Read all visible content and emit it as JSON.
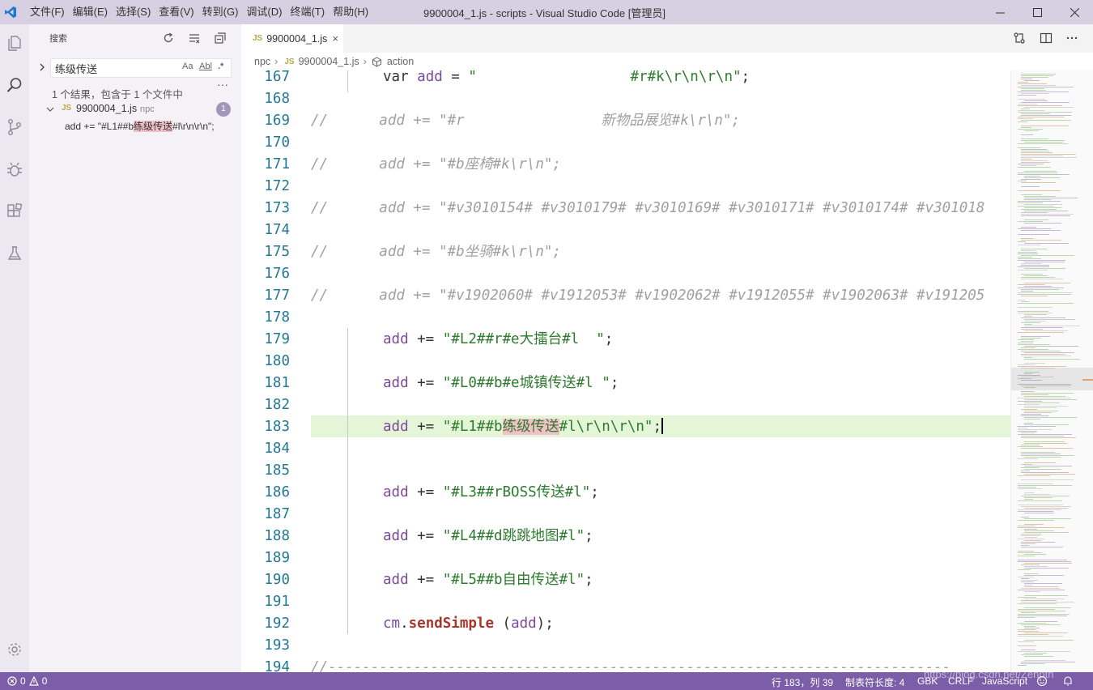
{
  "window": {
    "title": "9900004_1.js - scripts - Visual Studio Code [管理员]",
    "menu": [
      "文件(F)",
      "编辑(E)",
      "选择(S)",
      "查看(V)",
      "转到(G)",
      "调试(D)",
      "终端(T)",
      "帮助(H)"
    ]
  },
  "activity": [
    "explorer-icon",
    "search-icon",
    "source-control-icon",
    "debug-icon",
    "extensions-icon",
    "test-icon",
    "settings-icon"
  ],
  "sidebar": {
    "title": "搜索",
    "search_value": "练级传送",
    "options": {
      "match_case": "Aa",
      "whole_word": "Abl",
      "regex": ".*"
    },
    "result_message": "1 个结果，包含于 1 个文件中",
    "file": {
      "type": "JS",
      "name": "9900004_1.js",
      "path": "npc",
      "count": "1"
    },
    "match": {
      "before": "add += \"#L1##b",
      "hit": "练级传送",
      "after": "#l\\r\\n\\r\\n\";"
    }
  },
  "tabs": [
    {
      "type": "JS",
      "label": "9900004_1.js",
      "close": "×"
    }
  ],
  "breadcrumb": {
    "folder": "npc",
    "file_type": "JS",
    "file": "9900004_1.js",
    "symbol": "action",
    "sep": "›"
  },
  "editor": {
    "lines": [
      {
        "n": "167",
        "kind": "code",
        "parts": [
          {
            "c": "kw",
            "t": "var "
          },
          {
            "c": "id",
            "t": "add"
          },
          {
            "c": "op",
            "t": " = "
          },
          {
            "c": "str",
            "t": "\"                  #r#k\\r\\n\\r\\n\""
          },
          {
            "c": "op",
            "t": ";"
          }
        ]
      },
      {
        "n": "168",
        "kind": "blank",
        "parts": []
      },
      {
        "n": "169",
        "kind": "comment",
        "parts": [
          {
            "c": "cmt",
            "t": "//      add += \"#r                新物品展览#k\\r\\n\";"
          }
        ]
      },
      {
        "n": "170",
        "kind": "blank",
        "parts": []
      },
      {
        "n": "171",
        "kind": "comment",
        "parts": [
          {
            "c": "cmt",
            "t": "//      add += \"#b座椅#k\\r\\n\";"
          }
        ]
      },
      {
        "n": "172",
        "kind": "blank",
        "parts": []
      },
      {
        "n": "173",
        "kind": "comment",
        "parts": [
          {
            "c": "cmt",
            "t": "//      add += \"#v3010154# #v3010179# #v3010169# #v3010171# #v3010174# #v301018"
          }
        ]
      },
      {
        "n": "174",
        "kind": "blank",
        "parts": []
      },
      {
        "n": "175",
        "kind": "comment",
        "parts": [
          {
            "c": "cmt",
            "t": "//      add += \"#b坐骑#k\\r\\n\";"
          }
        ]
      },
      {
        "n": "176",
        "kind": "blank",
        "parts": []
      },
      {
        "n": "177",
        "kind": "comment",
        "parts": [
          {
            "c": "cmt",
            "t": "//      add += \"#v1902060# #v1912053# #v1902062# #v1912055# #v1902063# #v191205"
          }
        ]
      },
      {
        "n": "178",
        "kind": "blank",
        "parts": []
      },
      {
        "n": "179",
        "kind": "code",
        "parts": [
          {
            "c": "id",
            "t": "add"
          },
          {
            "c": "op",
            "t": " += "
          },
          {
            "c": "str",
            "t": "\"#L2##r#e大擂台#l  \""
          },
          {
            "c": "op",
            "t": ";"
          }
        ]
      },
      {
        "n": "180",
        "kind": "blank",
        "parts": []
      },
      {
        "n": "181",
        "kind": "code",
        "parts": [
          {
            "c": "id",
            "t": "add"
          },
          {
            "c": "op",
            "t": " += "
          },
          {
            "c": "str",
            "t": "\"#L0##b#e城镇传送#l \""
          },
          {
            "c": "op",
            "t": ";"
          }
        ]
      },
      {
        "n": "182",
        "kind": "blank",
        "parts": []
      },
      {
        "n": "183",
        "kind": "current",
        "parts": [
          {
            "c": "id",
            "t": "add"
          },
          {
            "c": "op",
            "t": " += "
          },
          {
            "c": "str",
            "t": "\"#L1##b"
          },
          {
            "c": "str mark",
            "t": "练级传送"
          },
          {
            "c": "str",
            "t": "#l\\r\\n\\r\\n\""
          },
          {
            "c": "op",
            "t": ";"
          }
        ]
      },
      {
        "n": "184",
        "kind": "blank",
        "parts": []
      },
      {
        "n": "185",
        "kind": "blank",
        "parts": []
      },
      {
        "n": "186",
        "kind": "code",
        "parts": [
          {
            "c": "id",
            "t": "add"
          },
          {
            "c": "op",
            "t": " += "
          },
          {
            "c": "str",
            "t": "\"#L3##rBOSS传送#l\""
          },
          {
            "c": "op",
            "t": ";"
          }
        ]
      },
      {
        "n": "187",
        "kind": "blank",
        "parts": []
      },
      {
        "n": "188",
        "kind": "code",
        "parts": [
          {
            "c": "id",
            "t": "add"
          },
          {
            "c": "op",
            "t": " += "
          },
          {
            "c": "str",
            "t": "\"#L4##d跳跳地图#l\""
          },
          {
            "c": "op",
            "t": ";"
          }
        ]
      },
      {
        "n": "189",
        "kind": "blank",
        "parts": []
      },
      {
        "n": "190",
        "kind": "code",
        "parts": [
          {
            "c": "id",
            "t": "add"
          },
          {
            "c": "op",
            "t": " += "
          },
          {
            "c": "str",
            "t": "\"#L5##b自由传送#l\""
          },
          {
            "c": "op",
            "t": ";"
          }
        ]
      },
      {
        "n": "191",
        "kind": "blank",
        "parts": []
      },
      {
        "n": "192",
        "kind": "code",
        "parts": [
          {
            "c": "id",
            "t": "cm"
          },
          {
            "c": "op",
            "t": "."
          },
          {
            "c": "fn",
            "t": "sendSimple"
          },
          {
            "c": "op",
            "t": " ("
          },
          {
            "c": "id",
            "t": "add"
          },
          {
            "c": "op",
            "t": ");"
          }
        ]
      },
      {
        "n": "193",
        "kind": "blank",
        "parts": []
      },
      {
        "n": "194",
        "kind": "comment",
        "parts": [
          {
            "c": "cmt",
            "t": "//-------------------------------------------------------------------------"
          }
        ]
      }
    ]
  },
  "status": {
    "errors": "0",
    "warnings": "0",
    "position": "行 183，列 39",
    "tab_size": "制表符长度: 4",
    "encoding": "GBK",
    "eol": "CRLF",
    "language": "JavaScript",
    "watermark": "https://blog.csdn.net/Zenpth"
  },
  "colors": {
    "titlebar": "#d7cfe2",
    "activitybar": "#ece8f1",
    "statusbar": "#7b5ea7",
    "current_line": "#e5f5d8",
    "match": "#f2c0c9"
  }
}
